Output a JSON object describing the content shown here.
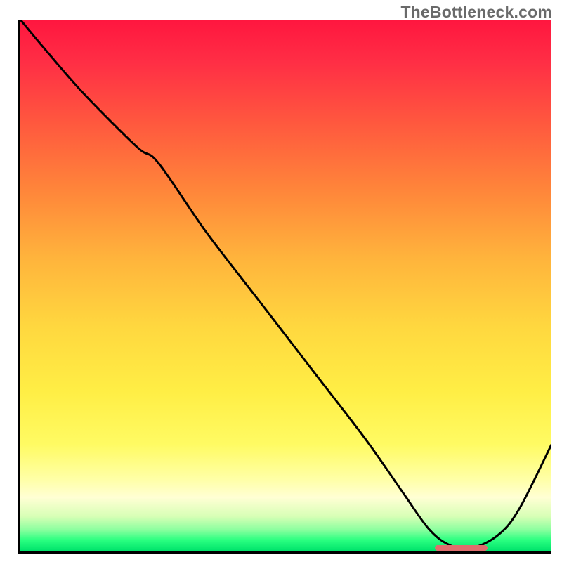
{
  "watermark": "TheBottleneck.com",
  "colors": {
    "axis": "#000000",
    "curve": "#000000",
    "min_marker": "#e06d6d",
    "gradient_top": "#ff163f",
    "gradient_bottom": "#00e36b"
  },
  "chart_data": {
    "type": "line",
    "title": "",
    "xlabel": "",
    "ylabel": "",
    "xlim": [
      0,
      100
    ],
    "ylim": [
      0,
      100
    ],
    "x": [
      0,
      5,
      12,
      22,
      26,
      35,
      45,
      55,
      65,
      72,
      77,
      81,
      85,
      90,
      94,
      100
    ],
    "values": [
      100,
      94,
      86,
      76,
      73,
      60,
      47,
      34,
      21,
      11,
      4,
      1,
      0.5,
      3,
      8,
      20
    ],
    "minimum_region": {
      "x_start": 78,
      "x_end": 88,
      "y": 0.5
    },
    "annotations": []
  }
}
